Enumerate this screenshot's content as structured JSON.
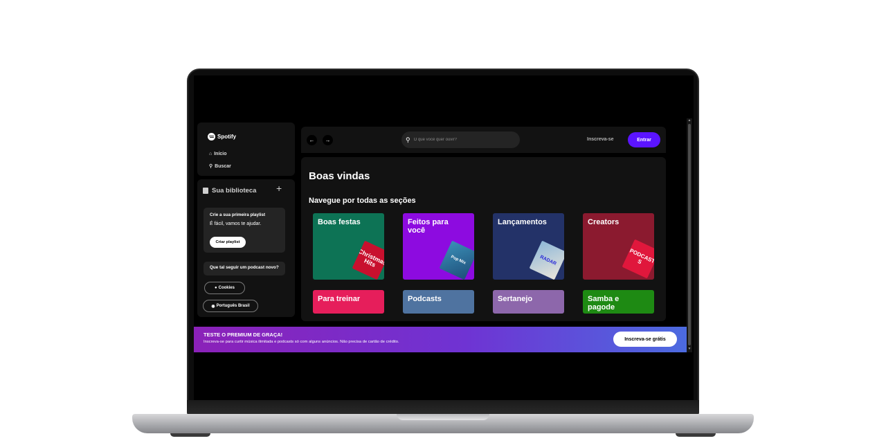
{
  "nav": {
    "brand": "Spotify",
    "items": [
      {
        "label": "Início",
        "icon": "home-icon"
      },
      {
        "label": "Buscar",
        "icon": "search-icon"
      }
    ]
  },
  "library": {
    "title": "Sua biblioteca",
    "add_icon": "plus-icon",
    "playlist_card": {
      "title": "Crie a sua primeira playlist",
      "subtitle": "É fácil, vamos te ajudar.",
      "button": "Criar playlist"
    },
    "podcast_card": {
      "title": "Que tal seguir um podcast novo?"
    },
    "cookies_label": "Cookies",
    "language_label": "Português Brasil"
  },
  "topbar": {
    "back_icon": "arrow-left-icon",
    "forward_icon": "arrow-right-icon",
    "search_placeholder": "O que você quer ouvir?",
    "signup_label": "Inscreva-se",
    "login_label": "Entrar"
  },
  "main": {
    "welcome": "Boas vindas",
    "section_title": "Navegue por todas as seções",
    "tiles": [
      {
        "label": "Boas festas",
        "color": "#0d7355",
        "art_text": "Christmas Hits",
        "art_color": "#c8102e"
      },
      {
        "label": "Feitos para você",
        "color": "#8d0be0",
        "art_text": "Pop Mix",
        "art_color": "#3a8fb7"
      },
      {
        "label": "Lançamentos",
        "color": "#233268",
        "art_text": "RADAR",
        "art_color": "#8fb8d8"
      },
      {
        "label": "Creators",
        "color": "#8b1a2f",
        "art_text": "PODCASTS",
        "art_color": "#e0173c"
      },
      {
        "label": "Para treinar",
        "color": "#e61e5b"
      },
      {
        "label": "Podcasts",
        "color": "#4f73a0"
      },
      {
        "label": "Sertanejo",
        "color": "#8d67ab"
      },
      {
        "label": "Samba e pagode",
        "color": "#1e8a13"
      }
    ]
  },
  "banner": {
    "title": "TESTE O PREMIUM DE GRAÇA!",
    "subtitle": "Inscreva-se para curtir música ilimitada e podcasts só com alguns anúncios. Não precisa de cartão de crédito.",
    "button": "Inscreva-se grátis"
  },
  "colors": {
    "accent": "#5b14ff",
    "panel": "#121212",
    "background": "#000000"
  }
}
